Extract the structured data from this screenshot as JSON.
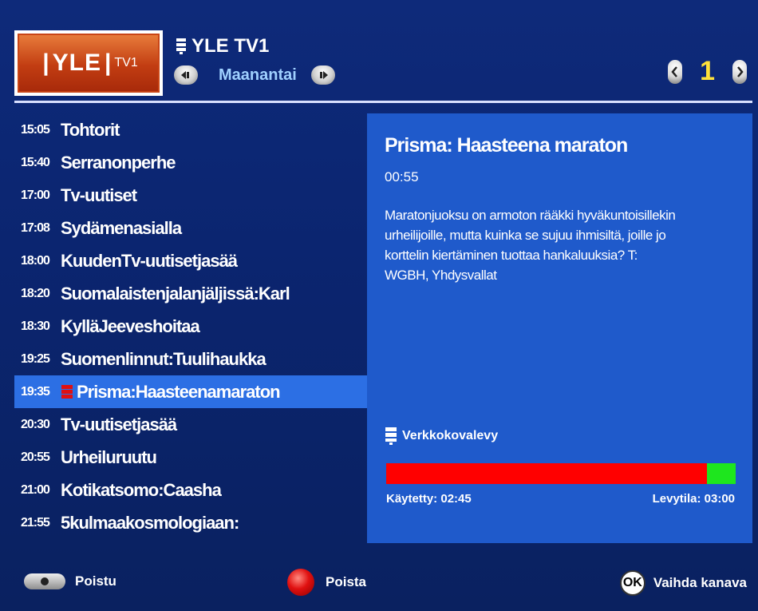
{
  "header": {
    "logo": {
      "brand": "YLE",
      "sub": "TV1"
    },
    "channel_title": "YLE TV1",
    "day": "Maanantai",
    "page_number": "1"
  },
  "programs": [
    {
      "time": "15:05",
      "title": "Tohtorit"
    },
    {
      "time": "15:40",
      "title": "Serranonperhe"
    },
    {
      "time": "17:00",
      "title": "Tv-uutiset"
    },
    {
      "time": "17:08",
      "title": "Sydämenasialla"
    },
    {
      "time": "18:00",
      "title": "KuudenTv-uutisetjasää"
    },
    {
      "time": "18:20",
      "title": "Suomalaistenjalanjäljissä:Karl"
    },
    {
      "time": "18:30",
      "title": "KylläJeeveshoitaa"
    },
    {
      "time": "19:25",
      "title": "Suomenlinnut:Tuulihaukka"
    },
    {
      "time": "19:35",
      "title": "Prisma:Haasteenamaraton",
      "selected": true,
      "recording": true
    },
    {
      "time": "20:30",
      "title": "Tv-uutisetjasää"
    },
    {
      "time": "20:55",
      "title": "Urheiluruutu"
    },
    {
      "time": "21:00",
      "title": "Kotikatsomo:Caasha"
    },
    {
      "time": "21:55",
      "title": "5kulmaakosmologiaan:"
    }
  ],
  "details": {
    "title": "Prisma: Haasteena maraton",
    "duration": "00:55",
    "description": "Maratonjuoksu on armoton rääkki hyväkuntoisillekin urheilijoille, mutta kuinka se sujuu ihmisiltä, joille jo korttelin kiertäminen tuottaa hankaluuksia? T: WGBH, Yhdysvallat"
  },
  "storage": {
    "label": "Verkkokovalevy",
    "used_label": "Käytetty: 02:45",
    "total_label": "Levytila: 03:00",
    "used_fraction": 0.917,
    "colors": {
      "used": "#ff0000",
      "free": "#1ee61e"
    }
  },
  "footer": {
    "exit_label": "Poistu",
    "delete_label": "Poista",
    "change_channel_label": "Vaihda kanava",
    "ok_text": "OK"
  }
}
